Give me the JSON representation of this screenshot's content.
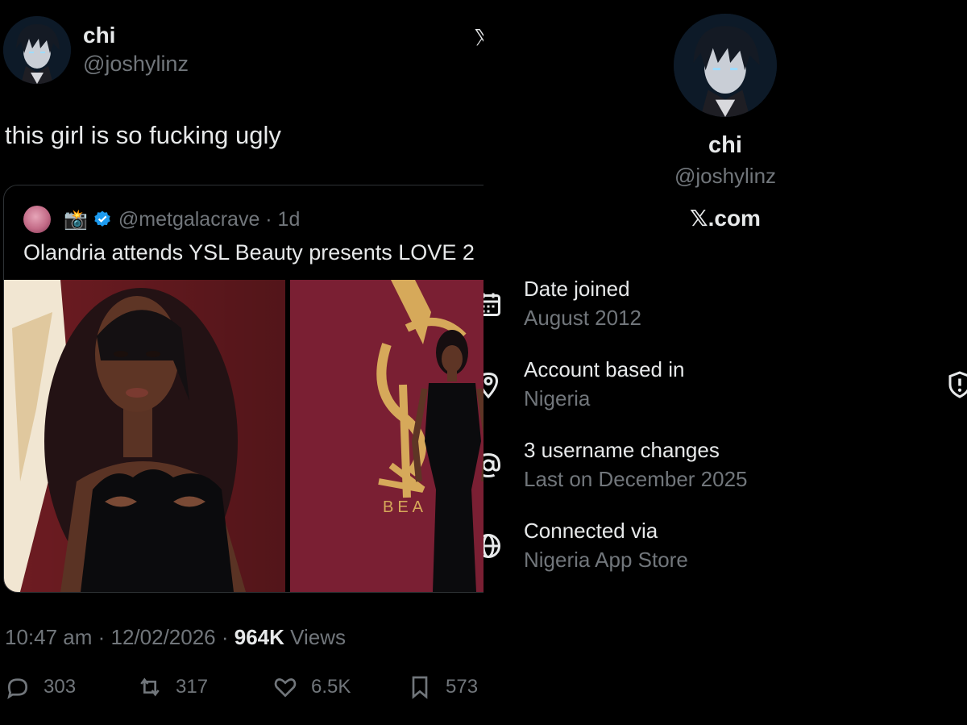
{
  "tweet": {
    "author_name": "chi",
    "author_handle": "@joshylinz",
    "text": "this girl is so fucking ugly",
    "quoted": {
      "emoji": "📸",
      "handle_time": "@metgalacrave · 1d",
      "text": "Olandria attends YSL Beauty presents LOVE 2",
      "photo_text": "BEA"
    },
    "timestamp": "10:47 am · 12/02/2026 · ",
    "views_count": "964K",
    "views_label": " Views",
    "actions": {
      "replies": "303",
      "reposts": "317",
      "likes": "6.5K",
      "bookmarks": "573"
    }
  },
  "profile": {
    "name": "chi",
    "handle": "@joshylinz",
    "site": "𝕏.com",
    "rows": [
      {
        "label": "Date joined",
        "value": "August 2012",
        "icon": "calendar-icon"
      },
      {
        "label": "Account based in",
        "value": "Nigeria",
        "icon": "location-pin-icon"
      },
      {
        "label": "3 username changes",
        "value": "Last on December 2025",
        "icon": "at-sign-icon"
      },
      {
        "label": "Connected via",
        "value": "Nigeria App Store",
        "icon": "globe-icon"
      }
    ]
  },
  "colors": {
    "background": "#000000",
    "primary_text": "#e7e9ea",
    "secondary_text": "#71767b",
    "border": "#2f3336",
    "verified": "#1d9bf0"
  }
}
